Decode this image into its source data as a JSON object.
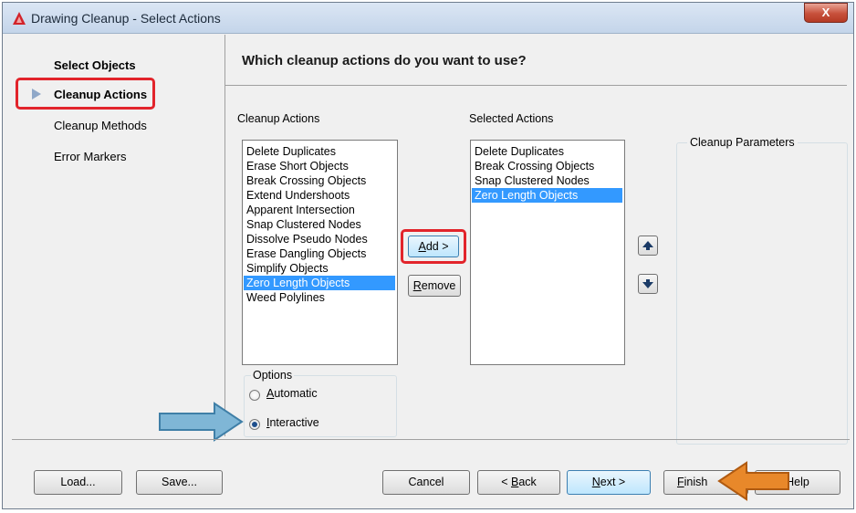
{
  "window": {
    "title": "Drawing Cleanup - Select Actions",
    "close_glyph": "X"
  },
  "nav": {
    "items": [
      {
        "label": "Select Objects",
        "active": false
      },
      {
        "label": "Cleanup Actions",
        "active": true
      },
      {
        "label": "Cleanup Methods",
        "active": false
      },
      {
        "label": "Error Markers",
        "active": false
      }
    ]
  },
  "main": {
    "heading": "Which cleanup actions do you want to use?",
    "actions_label": "Cleanup Actions",
    "selected_label": "Selected Actions",
    "params_label": "Cleanup Parameters",
    "actions": [
      "Delete Duplicates",
      "Erase Short Objects",
      "Break Crossing Objects",
      "Extend Undershoots",
      "Apparent Intersection",
      "Snap Clustered Nodes",
      "Dissolve Pseudo Nodes",
      "Erase Dangling Objects",
      "Simplify Objects",
      "Zero Length Objects",
      "Weed Polylines"
    ],
    "actions_selected_index": 9,
    "selected_actions": [
      "Delete Duplicates",
      "Break Crossing Objects",
      "Snap Clustered Nodes",
      "Zero Length Objects"
    ],
    "selected_actions_selected_index": 3,
    "add_button": {
      "label": "Add >",
      "mnemonic": "A",
      "rest": "dd >"
    },
    "remove_button": {
      "label": "Remove",
      "mnemonic": "R",
      "rest": "emove"
    },
    "options": {
      "label": "Options",
      "automatic": {
        "label": "Automatic",
        "mnemonic": "A",
        "rest": "utomatic",
        "checked": false
      },
      "interactive": {
        "label": "Interactive",
        "mnemonic": "I",
        "rest": "nteractive",
        "checked": true
      }
    }
  },
  "footer": {
    "load": "Load...",
    "save": "Save...",
    "cancel": "Cancel",
    "back": {
      "label": "< Back",
      "pre": "< ",
      "mnemonic": "B",
      "rest": "ack"
    },
    "next": {
      "label": "Next >",
      "mnemonic": "N",
      "rest": "ext >"
    },
    "finish": {
      "label": "Finish",
      "mnemonic": "F",
      "rest": "inish"
    },
    "help": "Help"
  },
  "colors": {
    "highlight": "#3399ff",
    "annotation_red": "#e2242b",
    "arrow_blue": "#7fb6d6",
    "arrow_orange": "#e8882a"
  },
  "icons": {
    "app": "autocad-logo-icon",
    "nav_pointer": "triangle-right-icon",
    "up": "arrow-up-icon",
    "down": "arrow-down-icon"
  }
}
